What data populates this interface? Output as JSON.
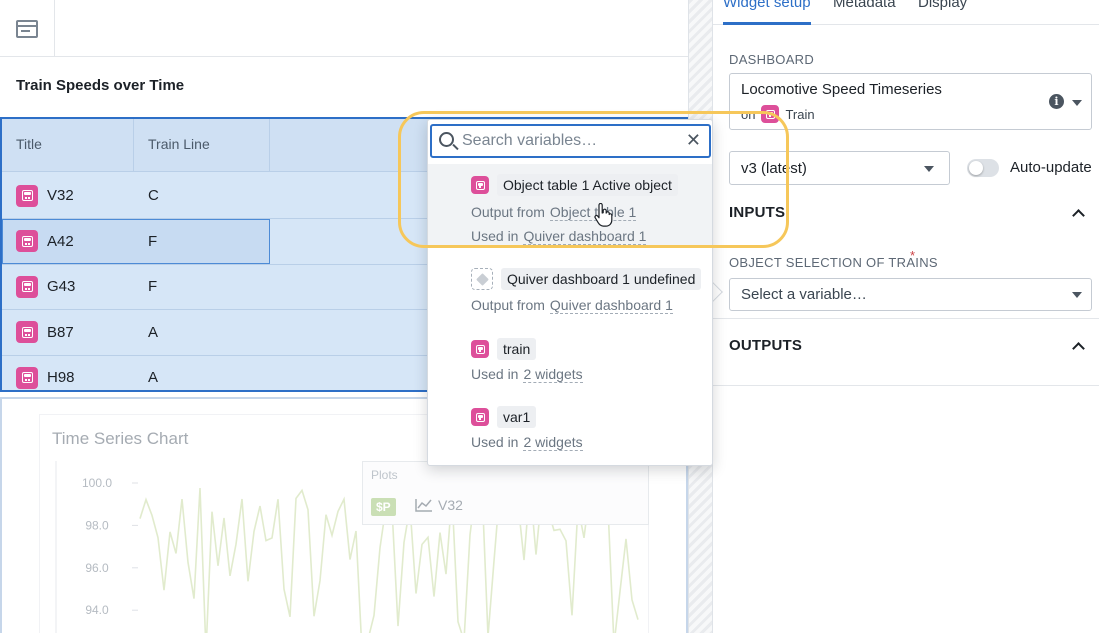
{
  "canvas": {
    "table_widget_title": "Train Speeds over Time",
    "table": {
      "columns": [
        "Title",
        "Train Line"
      ],
      "rows": [
        {
          "title": "V32",
          "line": "C"
        },
        {
          "title": "A42",
          "line": "F"
        },
        {
          "title": "G43",
          "line": "F"
        },
        {
          "title": "B87",
          "line": "A"
        },
        {
          "title": "H98",
          "line": "A"
        }
      ]
    },
    "chart_widget": {
      "title": "Time Series Chart",
      "plots_label": "Plots",
      "plot_tag": "$P",
      "series_name": "V32",
      "y_ticks": [
        "100.0",
        "98.0",
        "96.0",
        "94.0"
      ]
    }
  },
  "chart_data": {
    "type": "line",
    "title": "Time Series Chart",
    "ylim": [
      93.0,
      100.5
    ],
    "series": [
      {
        "name": "V32"
      }
    ]
  },
  "popover": {
    "search_placeholder": "Search variables…",
    "options": [
      {
        "name": "Object table 1 Active object",
        "meta1_prefix": "Output from",
        "meta1_link": "Object table 1",
        "meta2_prefix": "Used in",
        "meta2_link": "Quiver dashboard 1"
      },
      {
        "name": "Quiver dashboard 1 undefined",
        "meta1_prefix": "Output from",
        "meta1_link": "Quiver dashboard 1"
      },
      {
        "name": "train",
        "meta1_prefix": "Used in",
        "meta1_link": "2 widgets"
      },
      {
        "name": "var1",
        "meta1_prefix": "Used in",
        "meta1_link": "2 widgets"
      }
    ]
  },
  "panel": {
    "tabs": [
      "Widget setup",
      "Metadata",
      "Display"
    ],
    "dashboard_label": "DASHBOARD",
    "dashboard_name": "Locomotive Speed Timeseries",
    "dashboard_on_prefix": "on",
    "dashboard_on_object": "Train",
    "version": "v3 (latest)",
    "auto_update_label": "Auto-update",
    "inputs_label": "INPUTS",
    "object_selection_label": "OBJECT SELECTION OF TRAINS",
    "required_mark": "*",
    "variable_placeholder": "Select a variable…",
    "outputs_label": "OUTPUTS"
  },
  "colors": {
    "accent": "#2d6fc7",
    "object_badge": "#dd4f9a",
    "highlight": "#f6c75a",
    "series_line": "#c9dca5"
  }
}
